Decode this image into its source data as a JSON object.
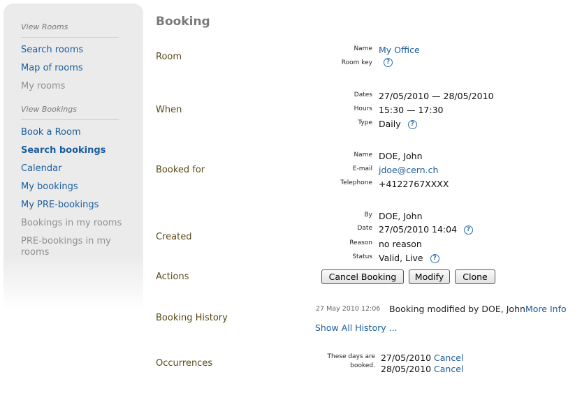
{
  "sidebar": {
    "rooms_section": "View Rooms",
    "rooms_items": [
      "Search rooms",
      "Map of rooms",
      "My rooms"
    ],
    "bookings_section": "View Bookings",
    "bookings_items": [
      "Book a Room",
      "Search bookings",
      "Calendar",
      "My bookings",
      "My PRE-bookings",
      "Bookings in my rooms",
      "PRE-bookings in my rooms"
    ]
  },
  "title": "Booking",
  "room": {
    "section": "Room",
    "name_label": "Name",
    "name": "My Office",
    "key_label": "Room key"
  },
  "when": {
    "section": "When",
    "dates_label": "Dates",
    "dates": "27/05/2010 — 28/05/2010",
    "hours_label": "Hours",
    "hours": "15:30 — 17:30",
    "type_label": "Type",
    "type": "Daily"
  },
  "booked_for": {
    "section": "Booked for",
    "name_label": "Name",
    "name": "DOE, John",
    "email_label": "E-mail",
    "email": "jdoe@cern.ch",
    "phone_label": "Telephone",
    "phone": "+4122767XXXX"
  },
  "created": {
    "section": "Created",
    "by_label": "By",
    "by": "DOE, John",
    "date_label": "Date",
    "date": "27/05/2010 14:04",
    "reason_label": "Reason",
    "reason": "no reason",
    "status_label": "Status",
    "status": "Valid, Live"
  },
  "actions": {
    "section": "Actions",
    "cancel": "Cancel Booking",
    "modify": "Modify",
    "clone": "Clone"
  },
  "history": {
    "section": "Booking History",
    "date": "27 May 2010 12:06",
    "text": "Booking modified by DOE, John",
    "more": "More Info",
    "show_all": "Show All History ..."
  },
  "occurrences": {
    "section": "Occurrences",
    "label": "These days are booked.",
    "items": [
      {
        "date": "27/05/2010",
        "action": "Cancel"
      },
      {
        "date": "28/05/2010",
        "action": "Cancel"
      }
    ]
  },
  "icons": {
    "help": "help-icon"
  },
  "colors": {
    "link": "#1a5d9c",
    "section_label": "#5a4a18",
    "title": "#7a7a7a"
  }
}
